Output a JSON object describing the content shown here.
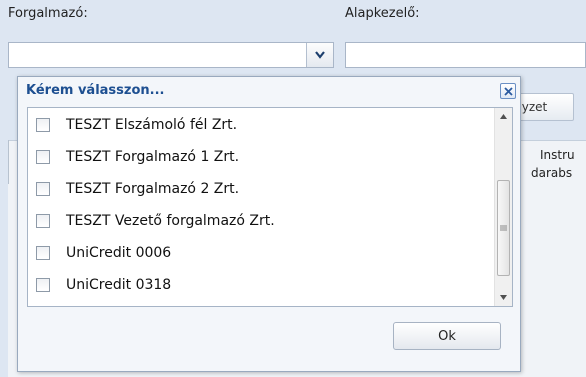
{
  "form": {
    "distributor_label": "Forgalmazó:",
    "fund_manager_label": "Alapkezelő:",
    "distributor_value": "",
    "fund_manager_value": ""
  },
  "background": {
    "button_partial_label": "elyzet",
    "column_header_line1": "Instru",
    "column_header_line2": "darabs"
  },
  "modal": {
    "title": "Kérem válasszon...",
    "close_icon": "close-icon",
    "items": [
      {
        "label": "TESZT Elszámoló fél Zrt.",
        "checked": false
      },
      {
        "label": "TESZT Forgalmazó 1 Zrt.",
        "checked": false
      },
      {
        "label": "TESZT Forgalmazó 2 Zrt.",
        "checked": false
      },
      {
        "label": "TESZT Vezető forgalmazó Zrt.",
        "checked": false
      },
      {
        "label": "UniCredit 0006",
        "checked": false
      },
      {
        "label": "UniCredit 0318",
        "checked": false
      }
    ],
    "ok_label": "Ok"
  },
  "colors": {
    "title": "#1d4f91",
    "background": "#dde6f2"
  }
}
